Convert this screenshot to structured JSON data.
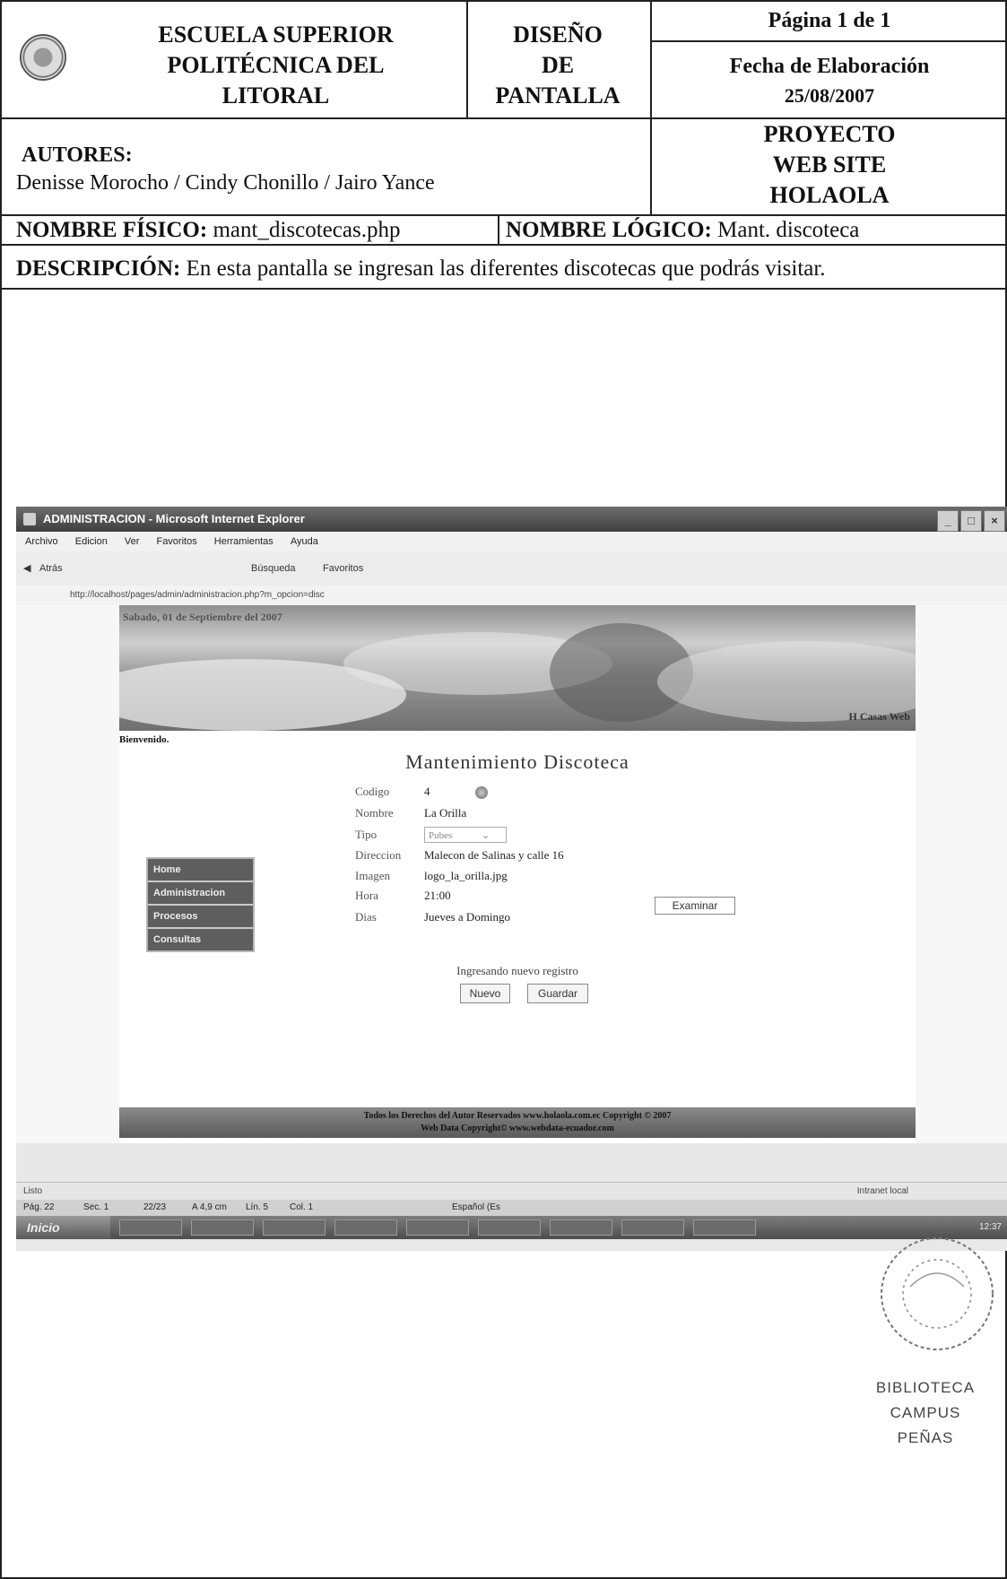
{
  "header": {
    "institution": [
      "ESCUELA SUPERIOR",
      "POLITÉCNICA DEL",
      "LITORAL"
    ],
    "doc_type": [
      "DISEÑO",
      "DE",
      "PANTALLA"
    ],
    "page": "Página 1 de 1",
    "fecha_label": "Fecha de Elaboración",
    "fecha_value": "25/08/2007",
    "autores_label": "AUTORES:",
    "autores_value": "Denisse Morocho  / Cindy Chonillo / Jairo Yance",
    "proyecto": [
      "PROYECTO",
      "WEB SITE",
      "HOLAOLA"
    ],
    "nombre_fisico_label": "NOMBRE FÍSICO:",
    "nombre_fisico_value": "mant_discotecas.php",
    "nombre_logico_label": "NOMBRE LÓGICO:",
    "nombre_logico_value": "Mant. discoteca",
    "descripcion_label": "DESCRIPCIÓN:",
    "descripcion_value": "En esta pantalla se ingresan las diferentes discotecas que podrás visitar."
  },
  "screenshot": {
    "window_title": "ADMINISTRACION - Microsoft Internet Explorer",
    "menu": [
      "Archivo",
      "Edicion",
      "Ver",
      "Favoritos",
      "Herramientas",
      "Ayuda"
    ],
    "toolbar": {
      "back": "Atrás",
      "search": "Búsqueda",
      "favorites": "Favoritos"
    },
    "address": "http://localhost/pages/admin/administracion.php?m_opcion=disc",
    "date_line": "Sabado, 01 de Septiembre del 2007",
    "banner_label": "H Casas Web",
    "welcome": "Bienvenido.",
    "form_title": "Mantenimiento Discoteca",
    "fields": {
      "codigo_label": "Codigo",
      "codigo_value": "4",
      "nombre_label": "Nombre",
      "nombre_value": "La Orilla",
      "tipo_label": "Tipo",
      "tipo_value": "Pubes",
      "direccion_label": "Direccion",
      "direccion_value": "Malecon de Salinas y calle 16",
      "imagen_label": "Imagen",
      "imagen_value": "logo_la_orilla.jpg",
      "hora_label": "Hora",
      "hora_value": "21:00",
      "dias_label": "Dias",
      "dias_value": "Jueves a Domingo"
    },
    "browse_button": "Examinar",
    "nav": [
      "Home",
      "Administracion",
      "Procesos",
      "Consultas"
    ],
    "status_text": "Ingresando nuevo registro",
    "new_button": "Nuevo",
    "save_button": "Guardar",
    "footer": [
      "Todos los Derechos del Autor Reservados www.holaola.com.ec Copyright © 2007",
      "Web Data Copyright© www.webdata-ecuador.com"
    ],
    "status_bar": {
      "left": "Listo",
      "right": "Intranet local"
    },
    "word_bar": {
      "pag": "Pág. 22",
      "sec": "Sec. 1",
      "count": "22/23",
      "pos": "A 4,9 cm",
      "lin": "Lín. 5",
      "col": "Col. 1",
      "lang": "Español (Es"
    },
    "taskbar": {
      "start": "Inicio",
      "clock": "12:37"
    }
  },
  "stamp": {
    "line1": "BIBLIOTECA",
    "line2": "CAMPUS",
    "line3": "PEÑAS"
  }
}
